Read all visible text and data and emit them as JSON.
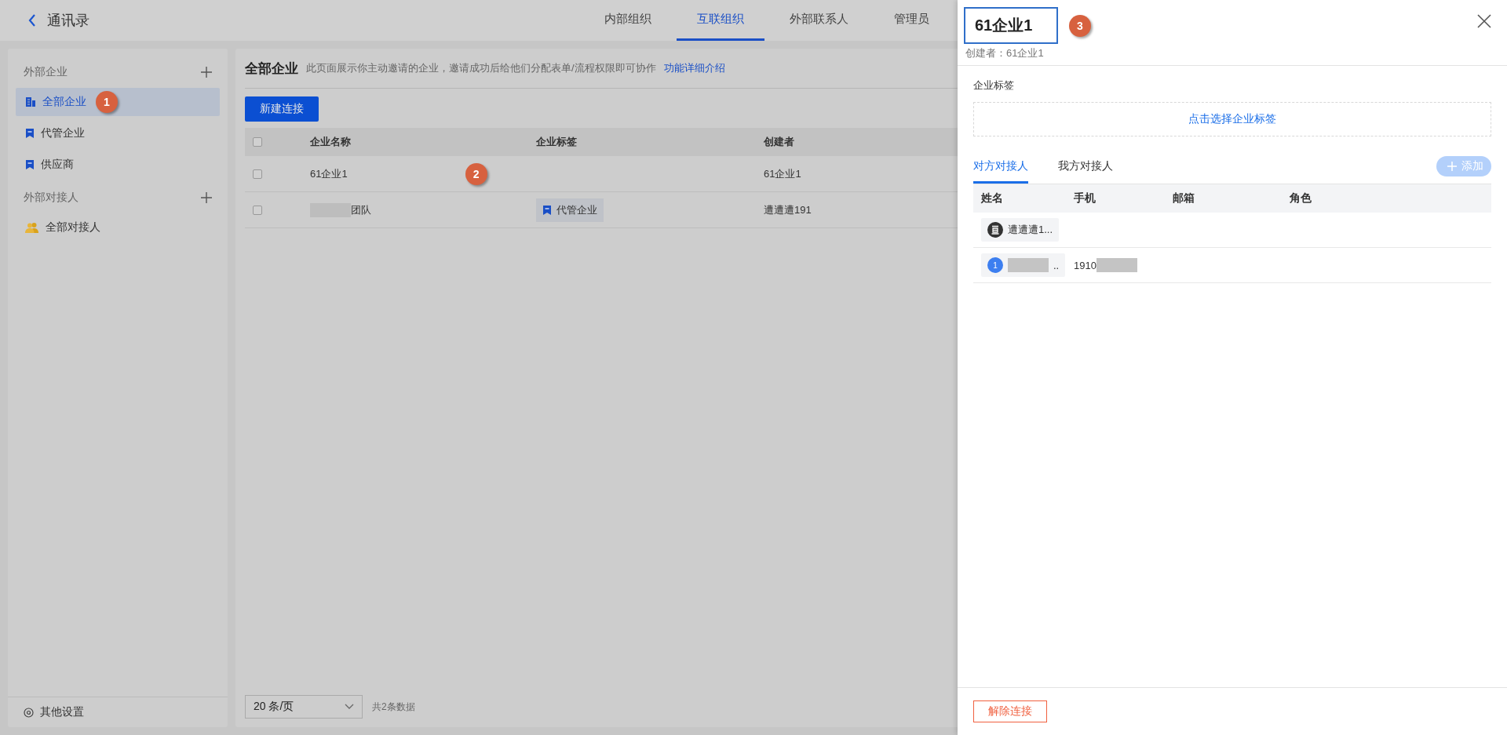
{
  "header": {
    "title": "通讯录"
  },
  "nav_tabs": [
    {
      "label": "内部组织",
      "selected": false
    },
    {
      "label": "互联组织",
      "selected": true
    },
    {
      "label": "外部联系人",
      "selected": false
    },
    {
      "label": "管理员",
      "selected": false
    }
  ],
  "sidebar": {
    "sections": [
      {
        "title": "外部企业",
        "items": [
          {
            "label": "全部企业",
            "selected": true,
            "kind": "building",
            "marker": "1"
          },
          {
            "label": "代管企业",
            "selected": false,
            "kind": "bookmark"
          },
          {
            "label": "供应商",
            "selected": false,
            "kind": "bookmark"
          }
        ]
      },
      {
        "title": "外部对接人",
        "items": [
          {
            "label": "全部对接人",
            "selected": false,
            "kind": "people"
          }
        ]
      }
    ],
    "footer": "其他设置"
  },
  "main": {
    "title": "全部企业",
    "description": "此页面展示你主动邀请的企业，邀请成功后给他们分配表单/流程权限即可协作",
    "link": "功能详细介绍",
    "new_button": "新建连接",
    "table": {
      "all_checked": false,
      "columns": [
        "企业名称",
        "企业标签",
        "创建者"
      ],
      "rows": [
        {
          "checked": false,
          "name": "61企业1",
          "name_redacted": false,
          "creator": "61企业1",
          "marker": "2"
        },
        {
          "checked": false,
          "name": "团队",
          "name_redacted": true,
          "tag": "代管企业",
          "creator": "遭遭遭191"
        }
      ]
    },
    "pagination": {
      "page_size": "20 条/页",
      "total": "共2条数据"
    }
  },
  "drawer": {
    "title": "61企业1",
    "marker": "3",
    "creator": "创建者：61企业1",
    "tag_label": "企业标签",
    "tag_picker": "点击选择企业标签",
    "tabs": [
      {
        "label": "对方对接人",
        "selected": true
      },
      {
        "label": "我方对接人",
        "selected": false
      }
    ],
    "add_button": {
      "label": "添加",
      "disabled": true
    },
    "columns": [
      "姓名",
      "手机",
      "邮箱",
      "角色"
    ],
    "contacts": [
      {
        "kind": "icon",
        "name": "遭遭遭1...",
        "name_redacted": false
      },
      {
        "kind": "number",
        "avatar_text": "1",
        "name": "..",
        "name_redacted": true,
        "phone": "1910",
        "phone_redacted": true
      }
    ],
    "unlink_button": "解除连接"
  }
}
